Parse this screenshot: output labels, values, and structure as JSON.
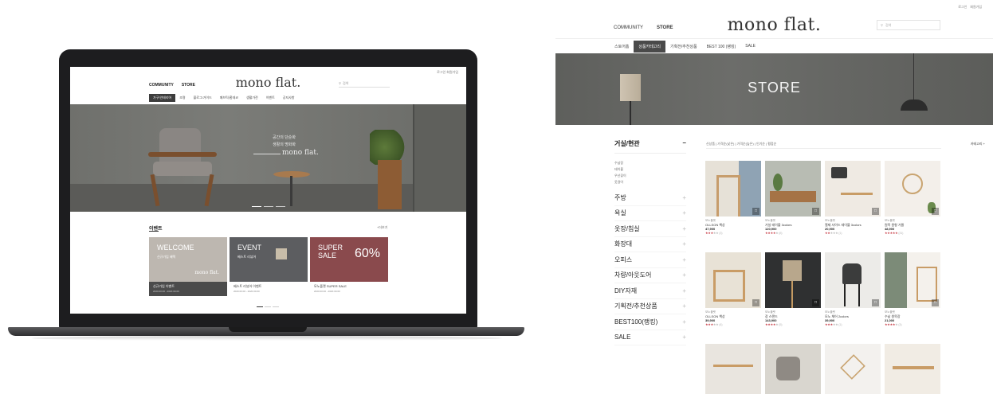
{
  "laptop": {
    "util": "로그인  회원가입",
    "nav": [
      "COMMUNITY",
      "STORE"
    ],
    "logo": "mono flat.",
    "search_placeholder": "검색",
    "menu": [
      "가구/인테리어",
      "조명",
      "블로그/가이드",
      "패브릭/홈데코",
      "생활가전",
      "이벤트",
      "공지사항"
    ],
    "menu_active": 0,
    "hero": {
      "line1": "공간의 단순화",
      "line2": "생활의 명화화",
      "brand": "mono flat."
    },
    "events": {
      "title": "이벤트",
      "more": "+더보기",
      "cards": [
        {
          "title": "WELCOME",
          "sub": "신규가입 혜택",
          "brand": "mono flat.",
          "cap": "신규가입 이벤트",
          "date": "2020.00.00 - 2020.00.00",
          "bg": "#bdb7b0"
        },
        {
          "title": "EVENT",
          "sub": "베스트 리뷰어",
          "cap": "베스트 리뷰어 이벤트",
          "date": "2020.00.00 - 2020.00.00",
          "bg": "#5c5d60"
        },
        {
          "title": "SUPER SALE",
          "big": "60%",
          "cap": "모노플랫 SUPER SALE",
          "date": "2020.00.00 - 2020.00.00",
          "bg": "#8a4a4d"
        }
      ]
    }
  },
  "store": {
    "util": [
      "로그인",
      "회원가입"
    ],
    "nav": [
      "COMMUNITY",
      "STORE"
    ],
    "logo": "mono flat.",
    "search_placeholder": "검색",
    "menu": [
      "스토어홈",
      "상품카테고리",
      "기획전/추천상품",
      "BEST 100 (랭킹)",
      "SALE"
    ],
    "menu_active": 1,
    "hero_title": "STORE",
    "sidebar": {
      "active": "거실/현관",
      "sub": [
        "수납장",
        "테이블",
        "우산꽂이",
        "옷걸이"
      ],
      "categories": [
        "주방",
        "욕실",
        "옷장/침실",
        "화장대",
        "오피스",
        "차량/아웃도어",
        "DIY자재",
        "기획전/추천상품",
        "BEST100(랭킹)",
        "SALE"
      ]
    },
    "sort": "신상품 | 가격순(낮은) | 가격순(높은) | 인기순 | 평점순",
    "sort_right": "카테고리 +",
    "products": [
      {
        "brand": "모노플랫",
        "name": "OLLSON 책상",
        "price": "47,900",
        "rating": 3,
        "reviews": "(3)"
      },
      {
        "brand": "모노플랫",
        "name": "거실 테이블 3colors",
        "price": "120,900",
        "rating": 4,
        "reviews": "(8)"
      },
      {
        "brand": "모노플랫",
        "name": "철제 사이드 테이블 3colors",
        "price": "20,900",
        "rating": 2,
        "reviews": "(1)"
      },
      {
        "brand": "모노플랫",
        "name": "원목 원형 거울",
        "price": "48,900",
        "rating": 5,
        "reviews": "(31)"
      },
      {
        "brand": "모노플랫",
        "name": "OLLSON 책상",
        "price": "39,900",
        "rating": 3,
        "reviews": "(4)"
      },
      {
        "brand": "모노플랫",
        "name": "장 스탠드",
        "price": "143,900",
        "rating": 4,
        "reviews": "(5)"
      },
      {
        "brand": "모노플랫",
        "name": "모노 체어 2colors",
        "price": "39,900",
        "rating": 3,
        "reviews": "(1)"
      },
      {
        "brand": "모노플랫",
        "name": "수납 원목장",
        "price": "21,000",
        "rating": 4,
        "reviews": "(3)"
      }
    ]
  }
}
